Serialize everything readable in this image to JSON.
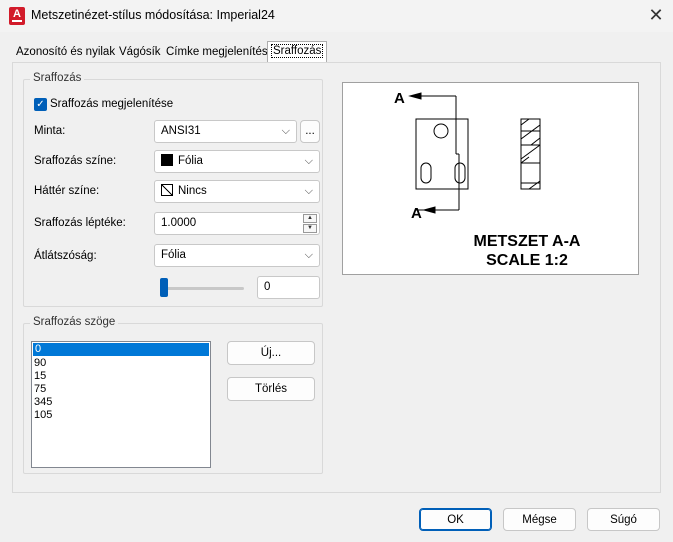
{
  "window": {
    "title": "Metszetinézet-stílus módosítása: Imperial24",
    "app_icon_letter": "A",
    "close_glyph": "✕"
  },
  "tabs": [
    {
      "label": "Azonosító és nyilak",
      "active": false
    },
    {
      "label": "Vágósík",
      "active": false
    },
    {
      "label": "Címke megjelenítése",
      "active": false
    },
    {
      "label": "Sraffozás",
      "active": true
    }
  ],
  "hatch_group": {
    "title": "Sraffozás",
    "show_checkbox": {
      "label": "Sraffozás megjelenítése",
      "checked": true
    },
    "pattern": {
      "label": "Minta:",
      "value": "ANSI31",
      "browse_label": "..."
    },
    "hatch_color": {
      "label": "Sraffozás színe:",
      "value": "Fólia",
      "swatch": "black-square"
    },
    "bg_color": {
      "label": "Háttér színe:",
      "value": "Nincs",
      "swatch": "none-square"
    },
    "scale": {
      "label": "Sraffozás léptéke:",
      "value": "1.0000"
    },
    "transparency": {
      "label": "Átlátszóság:",
      "value": "Fólia",
      "slider_value": "0",
      "slider_level": 0
    }
  },
  "angle_group": {
    "title": "Sraffozás szöge",
    "angles": [
      "0",
      "90",
      "15",
      "75",
      "345",
      "105"
    ],
    "selected": "0",
    "new_label": "Új...",
    "delete_label": "Törlés"
  },
  "preview": {
    "marker_top": "A",
    "marker_bottom": "A",
    "caption_line1": "METSZET A-A",
    "caption_line2": "SCALE 1:2"
  },
  "footer": {
    "ok_label": "OK",
    "cancel_label": "Mégse",
    "help_label": "Súgó"
  },
  "colors": {
    "accent": "#005fb8",
    "selection": "#0078d7"
  }
}
